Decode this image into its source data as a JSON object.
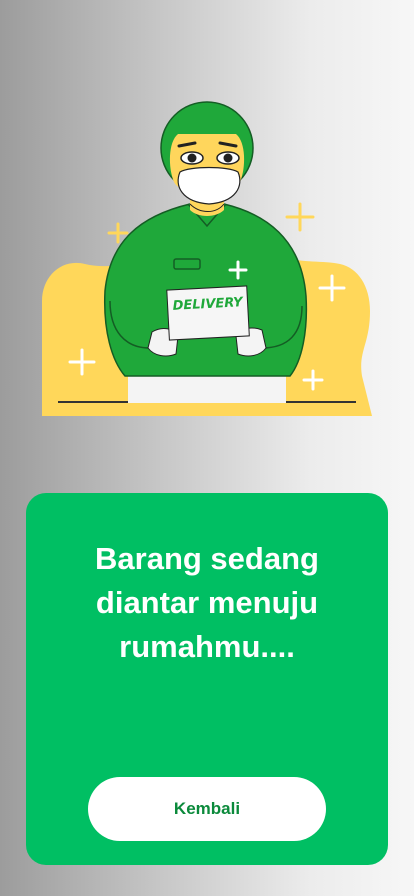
{
  "illustration": {
    "box_label": "DELIVERY",
    "colors": {
      "uniform": "#1fa83a",
      "accent": "#ffd75a",
      "skin": "#ffd65c"
    },
    "icon": "delivery-courier-illustration"
  },
  "card": {
    "color": "#00bf63",
    "message": "Barang sedang diantar menuju rumahmu....",
    "button_label": "Kembali"
  }
}
